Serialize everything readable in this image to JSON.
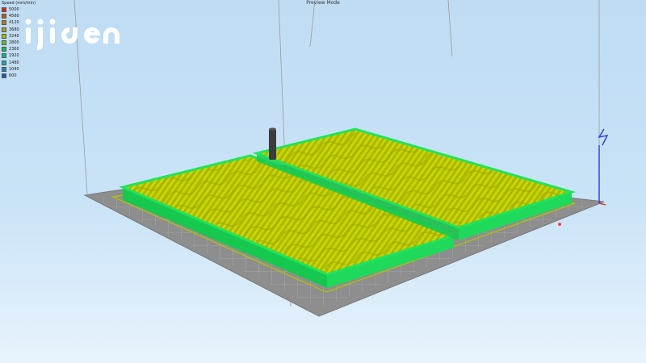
{
  "view": {
    "title": "Preview Mode"
  },
  "legend": {
    "title": "Speed (mm/min)",
    "entries": [
      {
        "label": "5000",
        "color": "#d42a14"
      },
      {
        "label": "4560",
        "color": "#c9511d"
      },
      {
        "label": "4120",
        "color": "#b57c1c"
      },
      {
        "label": "3680",
        "color": "#a8a21a"
      },
      {
        "label": "3240",
        "color": "#9ebc15"
      },
      {
        "label": "2800",
        "color": "#55c81c"
      },
      {
        "label": "2360",
        "color": "#1eb84a"
      },
      {
        "label": "1920",
        "color": "#19b688"
      },
      {
        "label": "1480",
        "color": "#16aab4"
      },
      {
        "label": "1040",
        "color": "#1a82c8"
      },
      {
        "label": "600",
        "color": "#2356b8"
      }
    ]
  },
  "logo": {
    "text": "ijigen",
    "color": "#ffffff"
  },
  "colors": {
    "infill": "#c8d400",
    "walls": "#22e35a",
    "bed": "#8e8e8e",
    "nozzle": "#3c3c3c"
  }
}
